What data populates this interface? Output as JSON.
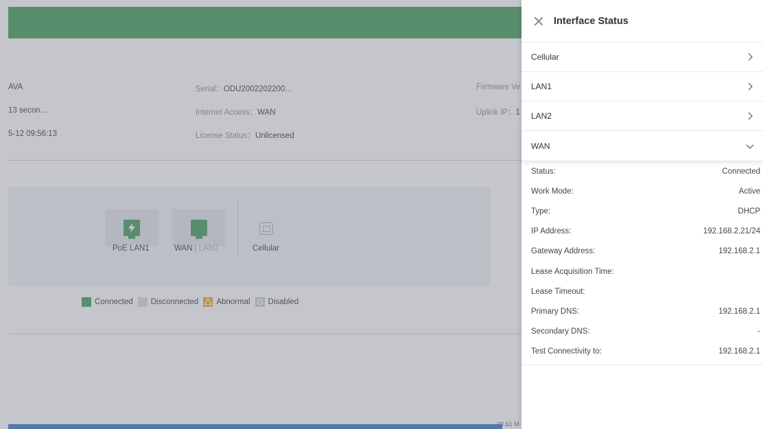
{
  "colors": {
    "brand_green": "#3f9b58",
    "abnormal": "#f0a020",
    "disabled": "#c8cbd1",
    "disconnected": "#d8dadf",
    "progress": "#2f78c4"
  },
  "background": {
    "info": [
      {
        "value": "AVA"
      },
      {
        "value": "13 secon..."
      },
      {
        "value": "5-12 09:56:13"
      },
      {
        "key": "Serial：",
        "value": "ODU2002202200..."
      },
      {
        "key": "Internet Access：",
        "value": "WAN"
      },
      {
        "key": "License Status：",
        "value": "Unlicensed"
      },
      {
        "key": "Firmware Ve"
      },
      {
        "key": "Uplink IP：",
        "value": "1"
      }
    ],
    "ports": [
      {
        "label": "PoE LAN1",
        "icon": "poe-port-icon"
      },
      {
        "label": "WAN",
        "sep": " | ",
        "alt": "LAN2",
        "icon": "ethernet-port-icon"
      },
      {
        "label": "Cellular",
        "icon": "sim-card-icon"
      }
    ],
    "legend": {
      "connected": "Connected",
      "disconnected": "Disconnected",
      "abnormal": "Abnormal",
      "disabled": "Disabled"
    },
    "progress_text": "39.61 M"
  },
  "drawer": {
    "title": "Interface Status",
    "sections": [
      {
        "label": "Cellular",
        "state": "collapsed"
      },
      {
        "label": "LAN1",
        "state": "collapsed"
      },
      {
        "label": "LAN2",
        "state": "collapsed"
      },
      {
        "label": "WAN",
        "state": "expanded"
      }
    ],
    "wan_details": [
      {
        "label": "Status:",
        "value": "Connected"
      },
      {
        "label": "Work Mode:",
        "value": "Active"
      },
      {
        "label": "Type:",
        "value": "DHCP"
      },
      {
        "label": "IP Address:",
        "value": "192.168.2.21/24"
      },
      {
        "label": "Gateway Address:",
        "value": "192.168.2.1"
      },
      {
        "label": "Lease Acquisition Time:",
        "value": ""
      },
      {
        "label": "Lease Timeout:",
        "value": ""
      },
      {
        "label": "Primary DNS:",
        "value": "192.168.2.1"
      },
      {
        "label": "Secondary DNS:",
        "value": "-"
      },
      {
        "label": "Test Connectivity to:",
        "value": "192.168.2.1"
      }
    ]
  }
}
